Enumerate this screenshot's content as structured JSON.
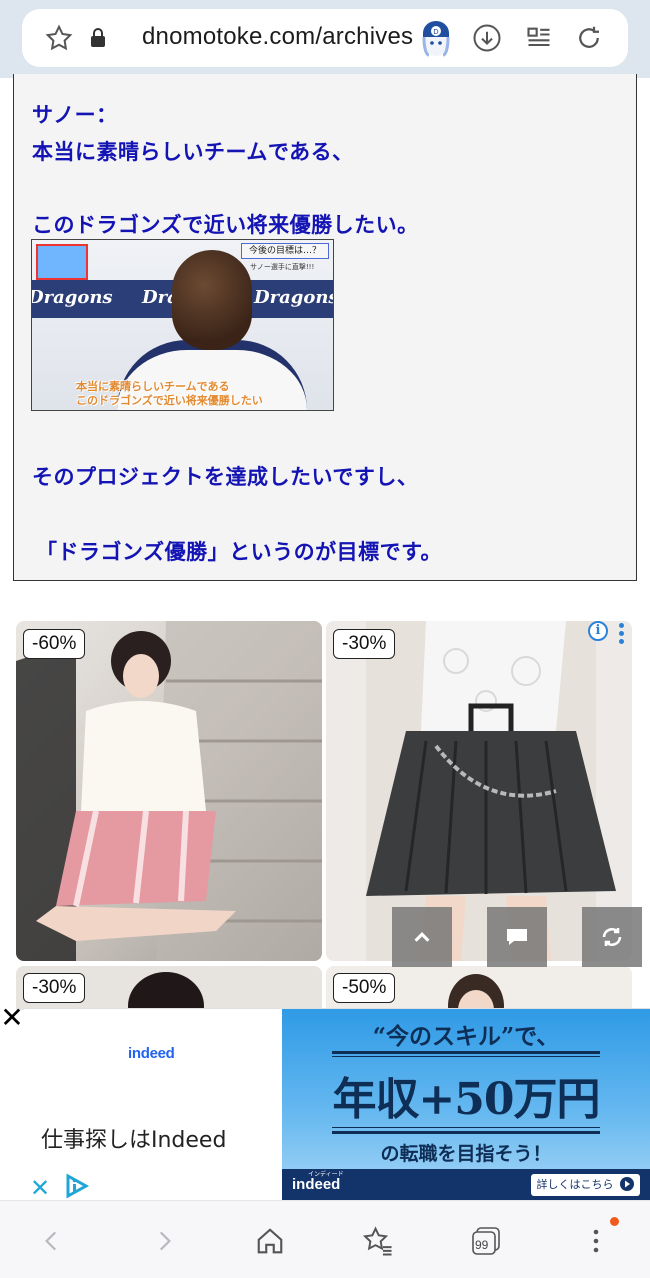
{
  "browser": {
    "url": "dnomotoke.com/archives",
    "tab_count": "99"
  },
  "article": {
    "speaker": "サノー：",
    "lines": [
      "本当に素晴らしいチームである、",
      "このドラゴンズで近い将来優勝したい。",
      "そのプロジェクトを達成したいですし、",
      "「ドラゴンズ優勝」というのが目標です。"
    ],
    "image": {
      "team_name": "Dragons",
      "caption_top": "今後の目標は…？",
      "caption_sub": "サノー選手に直撃!!!",
      "caption_line1": "本当に素晴らしいチームである",
      "caption_line2": "このドラゴンズで近い将来優勝したい"
    }
  },
  "ads_grid": {
    "tiles": [
      {
        "discount": "-60%"
      },
      {
        "discount": "-30%"
      },
      {
        "discount": "-30%"
      },
      {
        "discount": "-50%"
      }
    ],
    "info_icon": "i"
  },
  "banner": {
    "brand_logo": "indeed",
    "tagline": "仕事探しはIndeed",
    "headline_top": "“今のスキル”で、",
    "headline_main": "年収+50万円",
    "headline_bottom": "の転職を目指そう！",
    "footer_logo": "indeed",
    "footer_brand_reading": "インディード",
    "cta": "詳しくはこちら"
  },
  "colors": {
    "article_text": "#1414b4",
    "address_bar_bg": "#dde5ef",
    "indeed_blue": "#2164f3",
    "banner_navy": "#13346a",
    "notification_dot": "#f05a1e"
  }
}
